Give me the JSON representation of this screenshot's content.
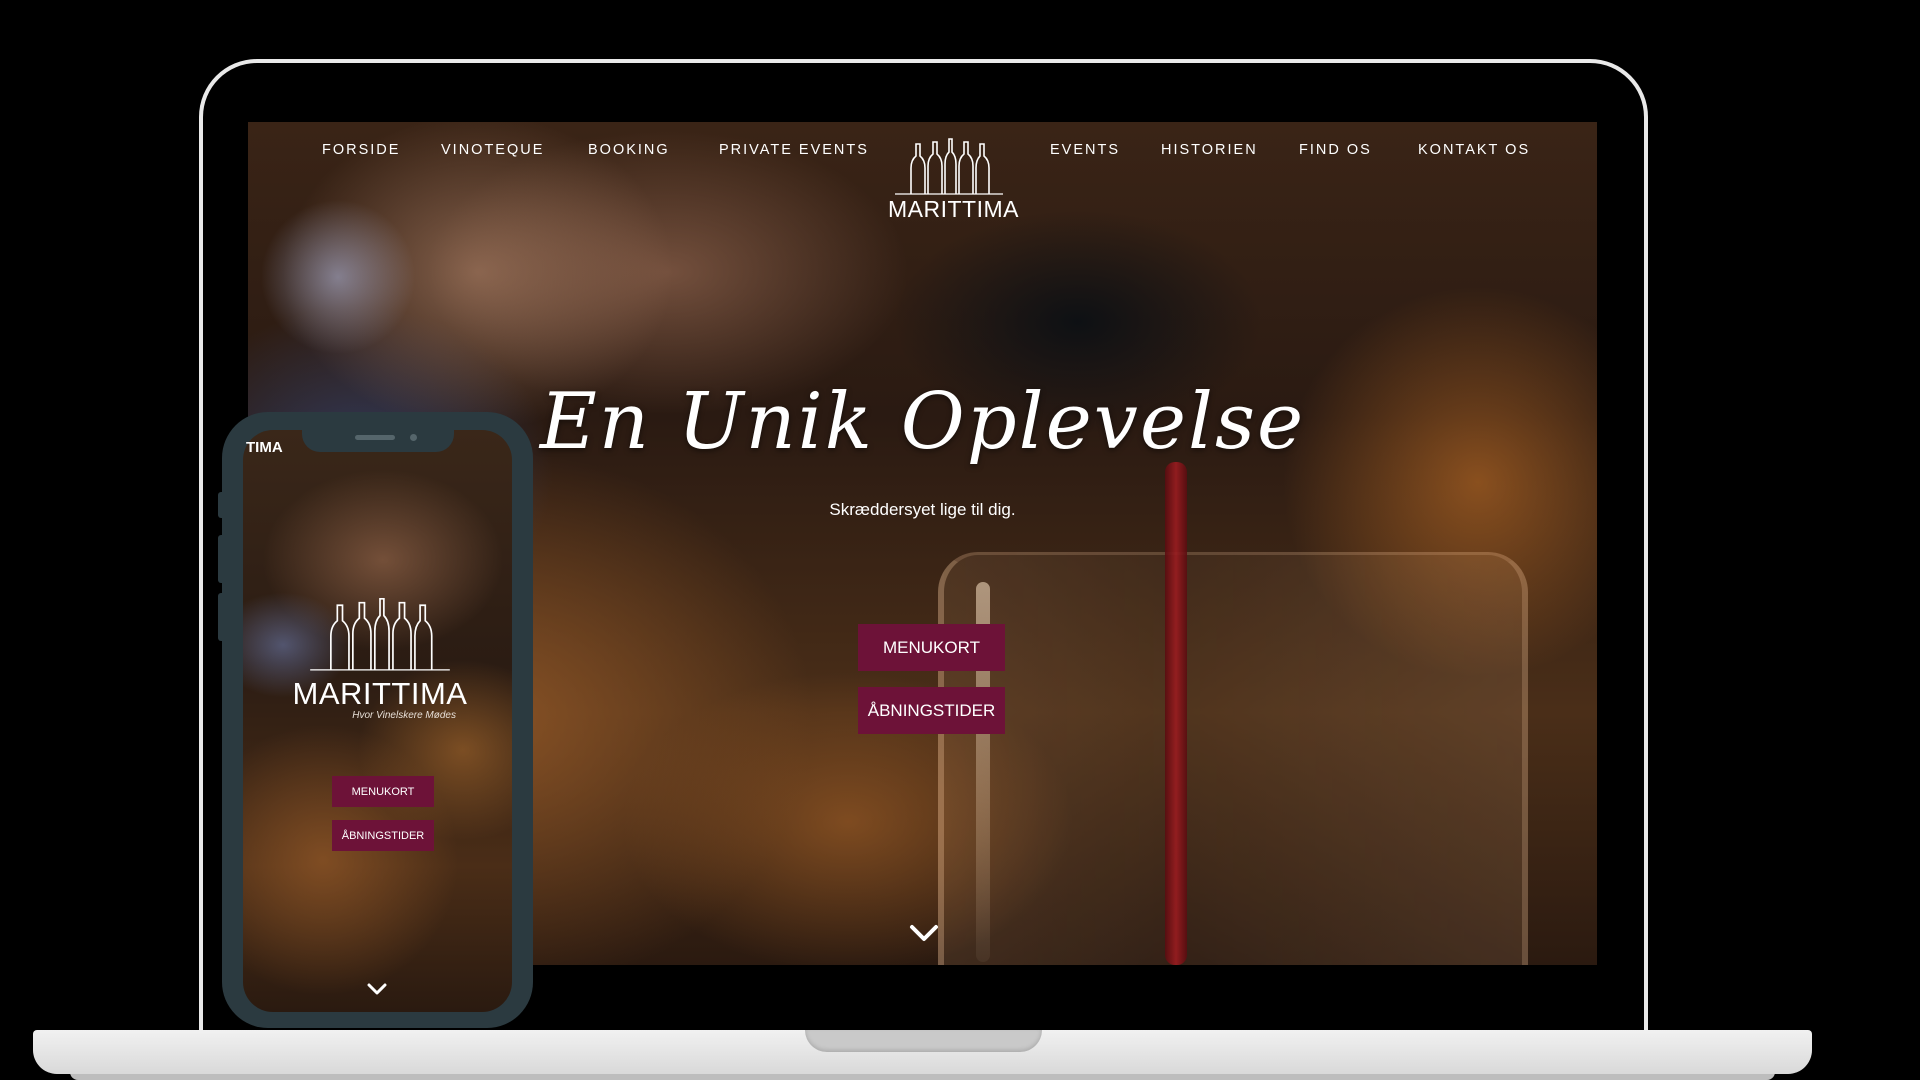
{
  "site": {
    "nav_left": [
      "FORSIDE",
      "VINOTEQUE",
      "BOOKING",
      "PRIVATE EVENTS"
    ],
    "nav_right": [
      "EVENTS",
      "HISTORIEN",
      "FIND OS",
      "KONTAKT OS"
    ],
    "logo_text": "MARITTIMA",
    "hero_title": "En Unik Oplevelse",
    "hero_subtitle": "Skræddersyet lige til dig.",
    "btn_menukort": "MENUKORT",
    "btn_abningstider": "ÅBNINGSTIDER",
    "scroll_icon": "chevron-down-icon",
    "logo_icon": "wine-bottles-icon"
  },
  "phone": {
    "top_text": "TIMA",
    "logo_text": "MARITTIMA",
    "tagline": "Hvor Vinelskere Mødes",
    "btn_menukort": "MENUKORT",
    "btn_abningstider": "ÅBNINGSTIDER"
  },
  "colors": {
    "accent": "#6d1238",
    "phone_frame": "#2b3a40",
    "laptop_frame": "#e9e9e9"
  }
}
